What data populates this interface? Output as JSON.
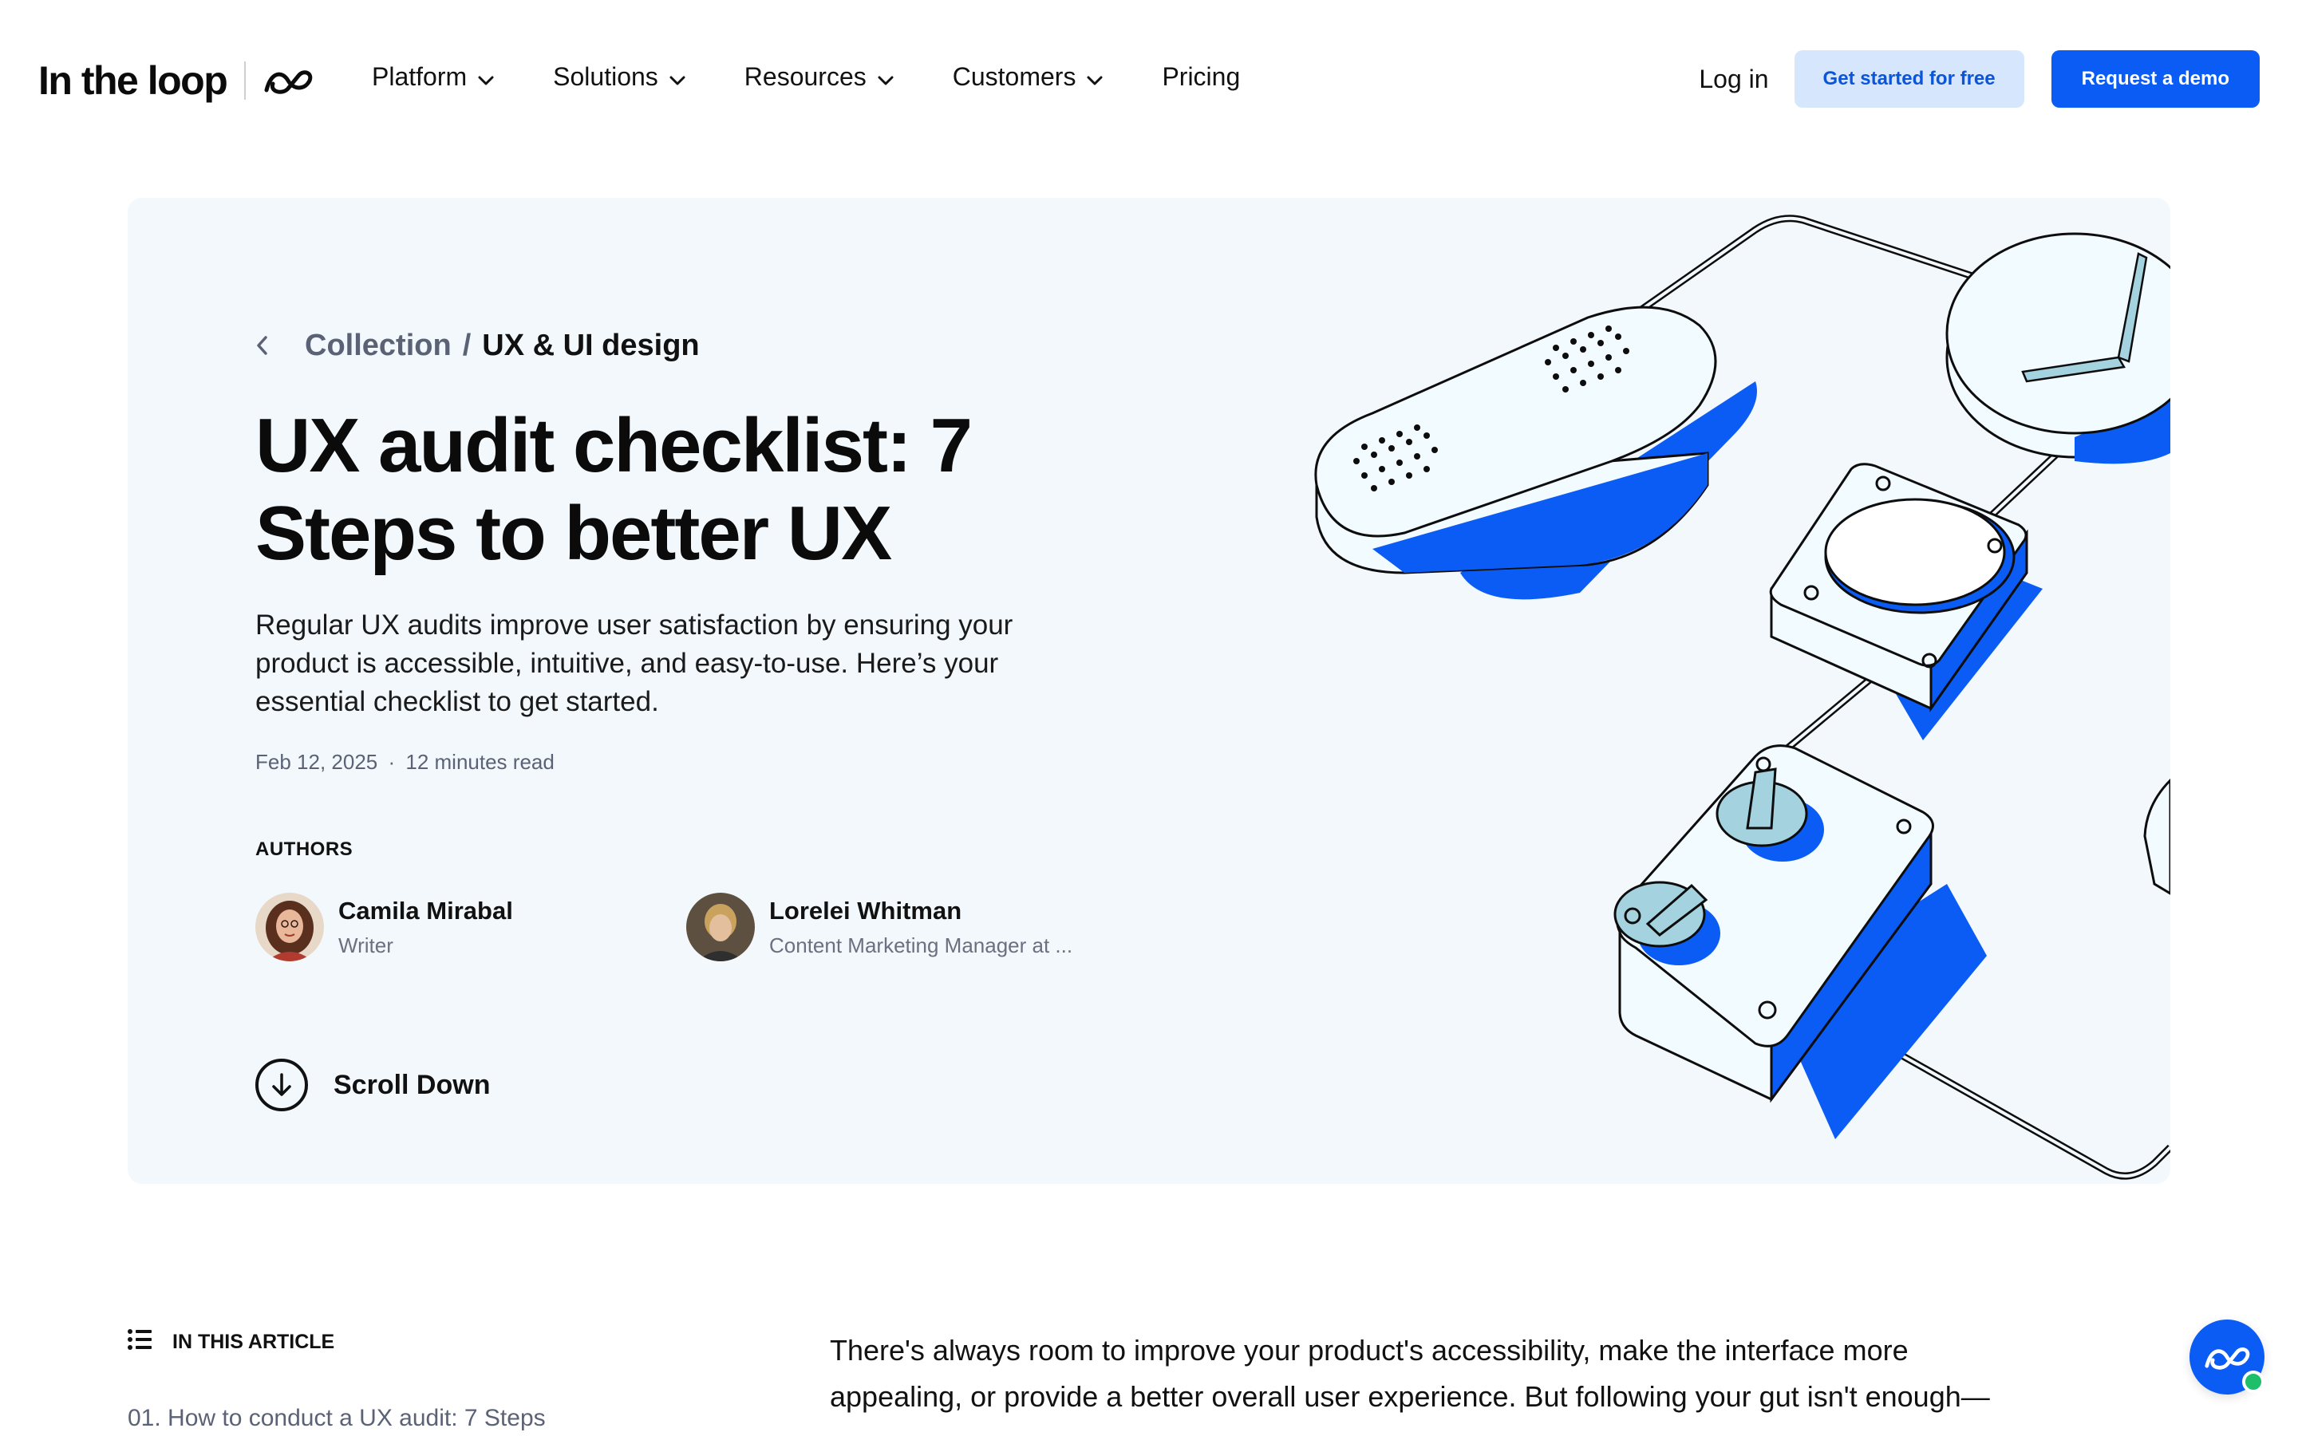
{
  "brand": {
    "logo_text": "In the loop",
    "primary_color": "#0a5cf5",
    "hero_background": "#f2f8fc"
  },
  "nav": {
    "items": [
      {
        "label": "Platform",
        "has_dropdown": true
      },
      {
        "label": "Solutions",
        "has_dropdown": true
      },
      {
        "label": "Resources",
        "has_dropdown": true
      },
      {
        "label": "Customers",
        "has_dropdown": true
      },
      {
        "label": "Pricing",
        "has_dropdown": false
      }
    ],
    "login": "Log in",
    "cta_free": "Get started for free",
    "cta_demo": "Request a demo"
  },
  "hero": {
    "breadcrumb": {
      "back_icon": "chevron-left-icon",
      "parent": "Collection",
      "separator": "/",
      "current": "UX & UI design"
    },
    "title": "UX audit checklist: 7 Steps to better UX",
    "subtitle": "Regular UX audits improve user satisfaction by ensuring your product is accessible, intuitive, and easy-to-use. Here’s your essential checklist to get started.",
    "date": "Feb 12, 2025",
    "meta_sep": "·",
    "read_time": "12 minutes read",
    "authors_label": "AUTHORS",
    "authors": [
      {
        "name": "Camila Mirabal",
        "role": "Writer"
      },
      {
        "name": "Lorelei Whitman",
        "role": "Content Marketing Manager at ..."
      }
    ],
    "scroll_label": "Scroll Down"
  },
  "toc": {
    "heading": "IN THIS ARTICLE",
    "items": [
      "01. How to conduct a UX audit: 7 Steps"
    ]
  },
  "article": {
    "intro": "There's always room to improve your product's accessibility, make the interface more appealing, or provide a better overall user experience. But following your gut isn't enough—"
  },
  "icons": {
    "logo_mark": "infinity-loop-icon",
    "chat": "chat-widget-icon",
    "scroll": "arrow-down-icon",
    "toc": "list-icon"
  }
}
